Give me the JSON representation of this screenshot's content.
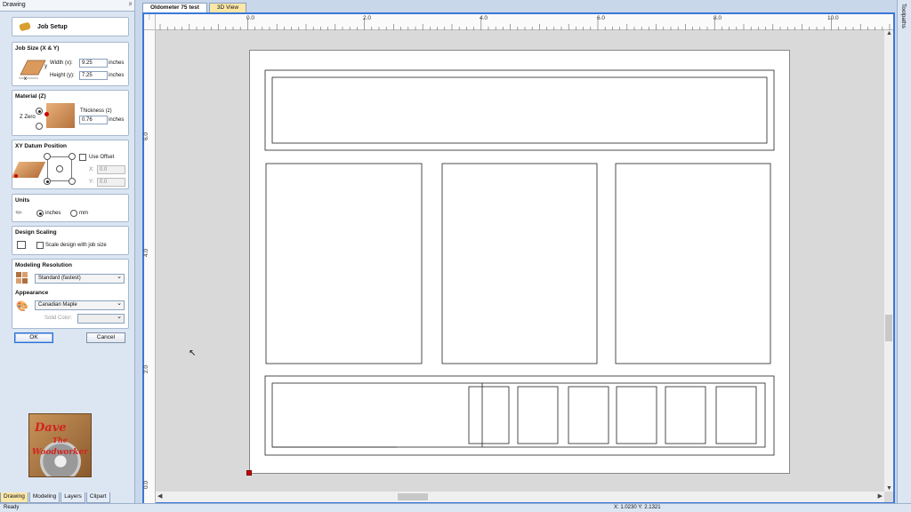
{
  "panel": {
    "title": "Drawing",
    "pin": "ᵖ"
  },
  "job_setup": {
    "label": "Job Setup"
  },
  "job_size": {
    "title": "Job Size (X & Y)",
    "axis_x": "x",
    "axis_y": "y",
    "width_label": "Width (x):",
    "width_value": "9.25",
    "width_unit": "inches",
    "height_label": "Height (y):",
    "height_value": "7.25",
    "height_unit": "inches"
  },
  "material": {
    "title": "Material (Z)",
    "zzero_label": "Z Zero",
    "thickness_label": "Thickness (z)",
    "thickness_value": "0.76",
    "thickness_unit": "inches"
  },
  "datum": {
    "title": "XY Datum Position",
    "use_offset_label": "Use Offset",
    "x_label": "X:",
    "x_value": "0.0",
    "y_label": "Y:",
    "y_value": "0.0"
  },
  "units": {
    "title": "Units",
    "inches_label": "inches",
    "mm_label": "mm"
  },
  "scaling": {
    "title": "Design Scaling",
    "scale_label": "Scale design with job size"
  },
  "resolution": {
    "title": "Modeling Resolution",
    "value": "Standard (fastest)"
  },
  "appearance": {
    "title": "Appearance",
    "material_value": "Canadian Maple",
    "solid_color_label": "Solid Color:"
  },
  "buttons": {
    "ok": "OK",
    "cancel": "Cancel"
  },
  "logo": {
    "line1": "Dave",
    "line2": "The",
    "line3": "Woodworker"
  },
  "bottom_tabs": [
    "Drawing",
    "Modeling",
    "Layers",
    "Clipart"
  ],
  "doc_tabs": {
    "active": "Oldometer 75 test",
    "view3d": "3D View"
  },
  "ruler": {
    "top": [
      "0.0",
      "2.0",
      "4.0",
      "6.0",
      "8.0",
      "10.0"
    ],
    "left": [
      "6.0",
      "4.0",
      "2.0",
      "0.0"
    ]
  },
  "right_panel": {
    "label": "Toolpaths"
  },
  "status": {
    "left": "Ready",
    "coords": "X: 1.0230 Y: 2.1321"
  },
  "colors": {
    "accent": "#3b78d8",
    "origin": "#cc0000",
    "tab_highlight": "#fbe7a8"
  }
}
